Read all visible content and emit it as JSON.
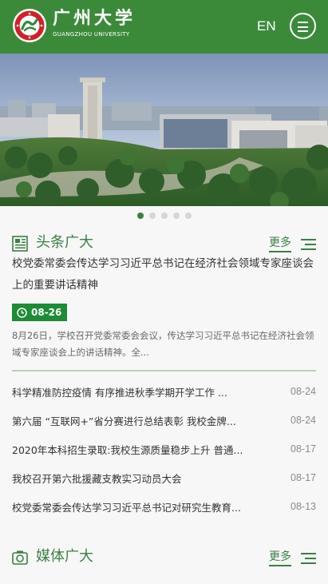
{
  "header": {
    "logo_icon": "university-emblem-icon",
    "name_cn": "广州大学",
    "name_en": "GUANGZHOU UNIVERSITY",
    "lang_label": "EN",
    "menu_icon": "hamburger-menu-icon",
    "background_color": "#3b8a3a"
  },
  "banner": {
    "image": "campus-aerial-photo",
    "slide_count": 5,
    "active_slide": 1
  },
  "headlines": {
    "icon": "newspaper-icon",
    "title": "头条广大",
    "more_label": "更多",
    "more_icon": "list-lines-icon",
    "top_story": {
      "title": "校党委常委会传达学习习近平总书记在经济社会领域专家座谈会上的重要讲话精神",
      "date": "08-26",
      "date_icon": "clock-icon",
      "summary": "8月26日，学校召开党委常委会会议，传达学习习近平总书记在经济社会领域专家座谈会上的讲话精神。全..."
    },
    "items": [
      {
        "title": "科学精准防控疫情 有序推进秋季学期开学工作 ...",
        "date": "08-24"
      },
      {
        "title": "第六届 “互联网+”省分赛进行总结表彰 我校金牌...",
        "date": "08-24"
      },
      {
        "title": "2020年本科招生录取:我校生源质量稳步上升 普通...",
        "date": "08-17"
      },
      {
        "title": "我校召开第六批援藏支教实习动员大会",
        "date": "08-17"
      },
      {
        "title": "校党委常委会传达学习习近平总书记对研究生教育...",
        "date": "08-13"
      }
    ],
    "accent_color": "#3b7f45",
    "badge_color": "#1d8c35"
  },
  "media": {
    "icon": "camera-icon",
    "title": "媒体广大",
    "more_label": "更多",
    "more_icon": "list-lines-icon"
  }
}
